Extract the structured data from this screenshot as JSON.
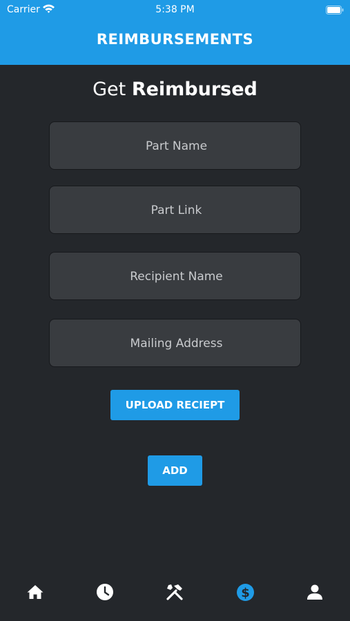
{
  "status_bar": {
    "carrier": "Carrier",
    "time": "5:38 PM"
  },
  "header": {
    "title": "REIMBURSEMENTS"
  },
  "form": {
    "heading_prefix": "Get",
    "heading_bold": "Reimbursed",
    "part_name_placeholder": "Part Name",
    "part_link_placeholder": "Part Link",
    "recipient_name_placeholder": "Recipient Name",
    "mailing_address_placeholder": "Mailing Address",
    "upload_label": "UPLOAD RECIEPT",
    "add_label": "ADD"
  },
  "tabs": [
    {
      "icon": "home-icon",
      "active": false
    },
    {
      "icon": "clock-icon",
      "active": false
    },
    {
      "icon": "tools-icon",
      "active": false
    },
    {
      "icon": "dollar-icon",
      "active": true
    },
    {
      "icon": "user-icon",
      "active": false
    }
  ],
  "colors": {
    "accent": "#1f9be6",
    "background": "#24272b",
    "field": "#393c40",
    "inactive_icon": "#ffffff"
  }
}
